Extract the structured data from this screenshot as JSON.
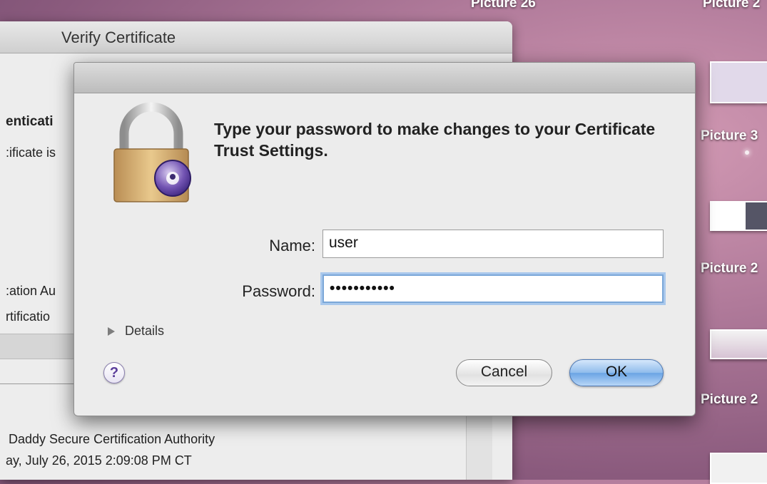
{
  "desktop": {
    "top_labels": [
      "Picture 26",
      "Picture 2"
    ],
    "side_labels": [
      "Picture 3",
      "Picture 2",
      "Picture 2"
    ]
  },
  "background_window": {
    "title": "Verify Certificate",
    "fragments": {
      "heading": "enticati",
      "line1": ":ificate is",
      "line2": ":ation Au",
      "line3": "rtificatio",
      "issuer": "Daddy Secure Certification Authority",
      "date": "ay, July 26, 2015 2:09:08 PM CT"
    }
  },
  "auth_dialog": {
    "message": "Type your password to make changes to your Certificate Trust Settings.",
    "name_label": "Name:",
    "name_value": "user",
    "password_label": "Password:",
    "password_value": "•••••••••••",
    "details_label": "Details",
    "help_label": "?",
    "cancel_label": "Cancel",
    "ok_label": "OK",
    "icon": "padlock-icon"
  },
  "colors": {
    "dialog_bg": "#ececec",
    "focus_ring": "#a9c8ec",
    "ok_button": "#6aa4e4"
  }
}
